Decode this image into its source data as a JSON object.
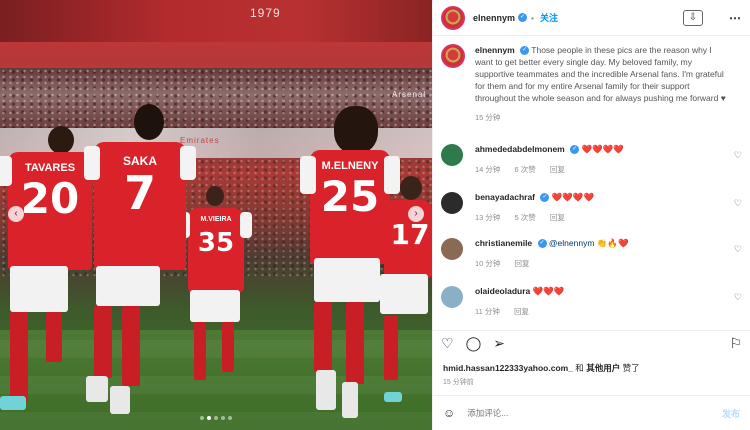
{
  "photo": {
    "players": [
      {
        "name": "TAVARES",
        "number": "20"
      },
      {
        "name": "SAKA",
        "number": "7"
      },
      {
        "name": "M.VIEIRA",
        "number": "35"
      },
      {
        "name": "M.ELNENY",
        "number": "25"
      },
      {
        "name": "",
        "number": "17"
      }
    ],
    "signs": [
      "1979",
      "Arsenal",
      "Emirates"
    ],
    "nav_prev": "‹",
    "nav_next": "›"
  },
  "header": {
    "username": "elnennym",
    "follow_label": "关注",
    "download_icon": "⇩",
    "more_icon": "⋯"
  },
  "caption": {
    "username": "elnennym",
    "text": "Those people in these pics are the reason why I want to get better every single day. My beloved family, my supportive teammates and the incredible Arsenal fans. I'm grateful for them and for my entire Arsenal family for their support throughout the whole season and for always pushing me forward ♥",
    "time": "15 分钟"
  },
  "comments": [
    {
      "username": "ahmededabdelmonem",
      "text": "❤️❤️❤️❤️",
      "time": "14 分钟",
      "likes": "6 次赞",
      "reply": "回复",
      "avatar_color": "#2e7a4a"
    },
    {
      "username": "benayadachraf",
      "text": "❤️❤️❤️❤️",
      "time": "13 分钟",
      "likes": "5 次赞",
      "reply": "回复",
      "avatar_color": "#2b2b2b"
    },
    {
      "username": "christianemile",
      "mention": "@elnennym",
      "text": "👏🔥❤️",
      "time": "10 分钟",
      "reply": "回复",
      "avatar_color": "#8a6a55"
    },
    {
      "username": "olaideoladura",
      "text": "❤️❤️❤️",
      "time": "11 分钟",
      "reply": "回复",
      "avatar_color": "#8ab0c8"
    }
  ],
  "likes": {
    "first_user": "hmid.hassan122333yahoo.com_",
    "connector": "和",
    "others": "其他用户",
    "suffix": "赞了"
  },
  "posted_ago": "15 分钟前",
  "add_comment": {
    "placeholder": "添加评论...",
    "post_label": "发布"
  },
  "colors": {
    "accent": "#0095f6",
    "verified": "#3897f0",
    "post_disabled": "#b2dffc",
    "arsenal_red": "#d92229"
  }
}
